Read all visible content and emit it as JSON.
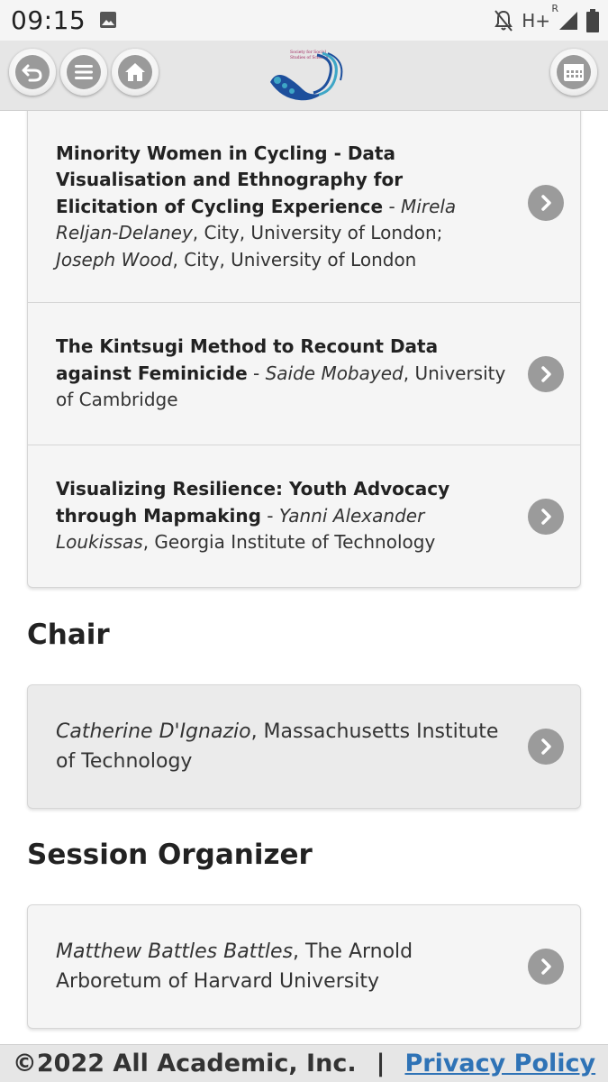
{
  "status_bar": {
    "time": "09:15",
    "network": "H+",
    "roaming": "R",
    "icons": [
      "image-icon",
      "bell-off-icon",
      "signal-icon",
      "battery-icon"
    ]
  },
  "nav": {
    "buttons": [
      "back-icon",
      "menu-icon",
      "home-icon",
      "calendar-icon"
    ],
    "logo_lines": [
      "Society for Social",
      "Studies of Science"
    ]
  },
  "papers": [
    {
      "title": "Minority Women in Cycling - Data Visualisation and Ethnography for Elicitation of Cycling Experience",
      "sep": " - ",
      "author1": "Mirela Reljan-Delaney",
      "affil1": ", City, University of London; ",
      "author2": "Joseph Wood",
      "affil2": ", City, University of London"
    },
    {
      "title": "The Kintsugi Method to Recount Data against Feminicide",
      "sep": " - ",
      "author1": "Saide Mobayed",
      "affil1": ", University of Cambridge"
    },
    {
      "title": "Visualizing Resilience: Youth Advocacy through Mapmaking",
      "sep": " - ",
      "author1": "Yanni Alexander Loukissas",
      "affil1": ", Georgia Institute of Technology"
    }
  ],
  "chair": {
    "heading": "Chair",
    "name": "Catherine D'Ignazio",
    "affiliation": ", Massachusetts Institute of Technology"
  },
  "organizer": {
    "heading": "Session Organizer",
    "name": "Matthew Battles Battles",
    "affiliation": ", The Arnold Arboretum of Harvard University"
  },
  "footer": {
    "copyright": "©2022 All Academic, Inc.",
    "divider": "|",
    "privacy": "Privacy Policy"
  },
  "colors": {
    "button_gray": "#9b9b9b",
    "card_bg": "#f5f5f5",
    "link": "#2f73b6",
    "logo_blue": "#1d4f9c",
    "logo_teal": "#3ea6c6"
  }
}
